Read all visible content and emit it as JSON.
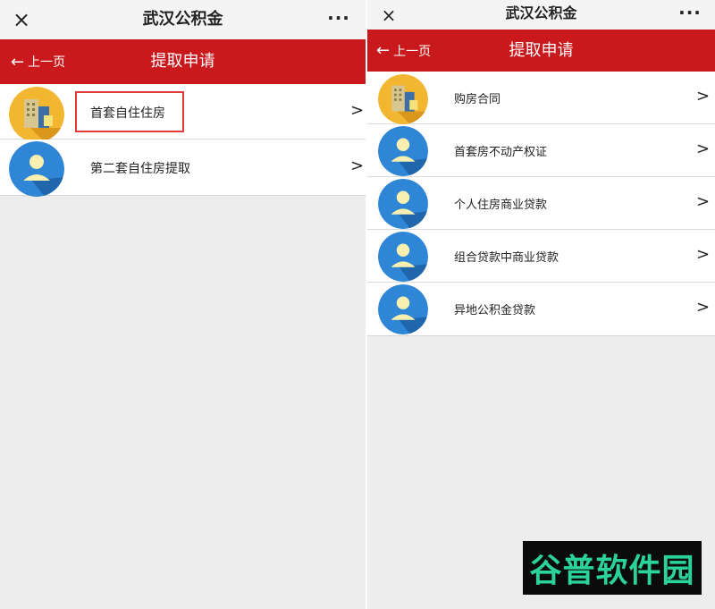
{
  "left": {
    "wechat": {
      "title": "武汉公积金",
      "close_icon": "×",
      "more_icon": "···"
    },
    "header": {
      "back_label": "上一页",
      "back_icon": "←",
      "title": "提取申请"
    },
    "items": [
      {
        "label": "首套自住住房",
        "icon": "building-icon",
        "chevron": ">"
      },
      {
        "label": "第二套自住房提取",
        "icon": "user-icon",
        "chevron": ">"
      }
    ]
  },
  "right": {
    "wechat": {
      "title": "武汉公积金",
      "close_icon": "×",
      "more_icon": "···"
    },
    "header": {
      "back_label": "上一页",
      "back_icon": "←",
      "title": "提取申请"
    },
    "items": [
      {
        "label": "购房合同",
        "icon": "building-icon",
        "chevron": ">"
      },
      {
        "label": "首套房不动产权证",
        "icon": "user-icon",
        "chevron": ">"
      },
      {
        "label": "个人住房商业贷款",
        "icon": "user-icon",
        "chevron": ">"
      },
      {
        "label": "组合贷款中商业贷款",
        "icon": "user-icon",
        "chevron": ">"
      },
      {
        "label": "异地公积金贷款",
        "icon": "user-icon",
        "chevron": ">"
      }
    ]
  },
  "watermark": {
    "text": "谷普软件园"
  },
  "colors": {
    "header_red": "#c9191c",
    "building_yellow": "#f2b630",
    "user_blue": "#2f86d6",
    "highlight": "#e23a3a"
  }
}
